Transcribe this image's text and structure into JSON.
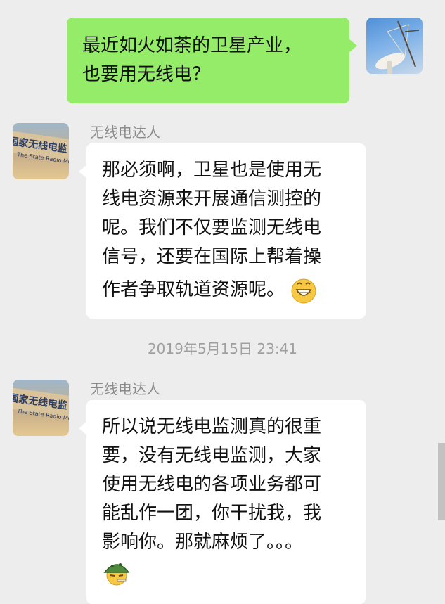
{
  "messages": [
    {
      "sender": "self",
      "text_lines": [
        "最近如火如荼的卫星产业，",
        "也要用无线电？"
      ]
    },
    {
      "sender": "other",
      "name": "无线电达人",
      "text_lines": [
        "那必须啊，卫星也是使用无",
        "线电资源来开展通信测控的",
        "呢。我们不仅要监测无线电",
        "信号，还要在国际上帮着操",
        "作者争取轨道资源呢。"
      ],
      "emoji": "grinning-face-emoji"
    },
    {
      "sender": "other",
      "name": "无线电达人",
      "text_lines": [
        "所以说无线电监测真的很重",
        "要，没有无线电监测，大家",
        "使用无线电的各项业务都可",
        "能乱作一团，你干扰我，我",
        "影响你。那就麻烦了。。。"
      ],
      "emoji": "soldier-helmet-emoji"
    }
  ],
  "timestamp": "2019年5月15日 23:41",
  "avatar_sign": {
    "text": "国家无线电监",
    "subtext": "The State Radio Moni"
  },
  "colors": {
    "self_bubble": "#95ec69",
    "other_bubble": "#ffffff",
    "background": "#ededed"
  }
}
